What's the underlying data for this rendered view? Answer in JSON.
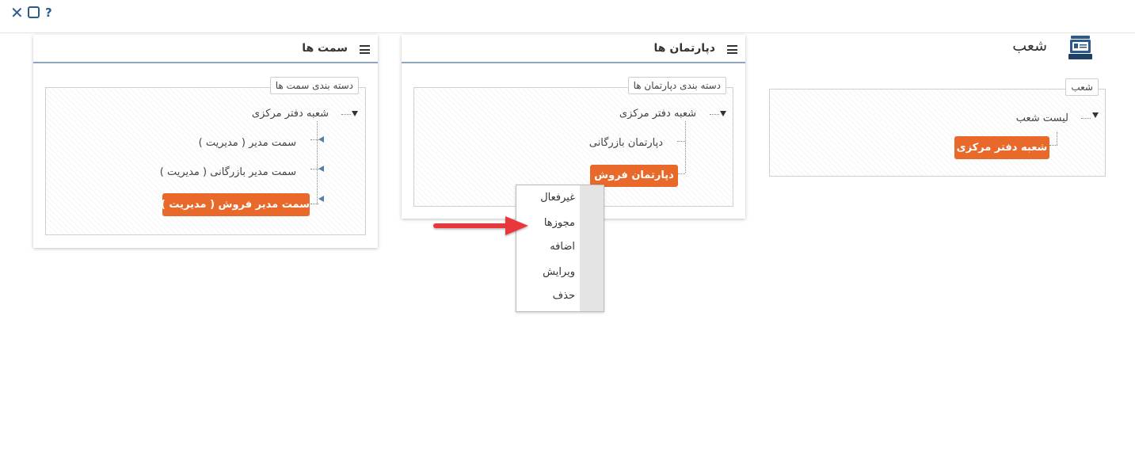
{
  "window_controls": {
    "close_icon": "close-icon",
    "maximize_icon": "maximize-icon",
    "help_label": "?"
  },
  "page": {
    "title": "شعب",
    "icon": "branch-icon"
  },
  "panels": {
    "positions": {
      "header_title": "سمت ها",
      "legend": "دسته بندی سمت ها",
      "root": "شعبه دفتر مرکزی",
      "items": [
        "سمت مدیر ( مدیریت )",
        "سمت مدیر بازرگانی ( مدیریت )"
      ],
      "selected": "سمت مدیر فروش ( مدیریت )"
    },
    "departments": {
      "header_title": "دپارتمان ها",
      "legend": "دسته بندی دپارتمان ها",
      "root": "شعبه دفتر مرکزی",
      "items": [
        "دپارتمان بازرگانی"
      ],
      "selected": "دپارتمان فروش"
    },
    "branches": {
      "legend": "شعب",
      "root": "لیست شعب",
      "selected": "شعبه دفتر مرکزی"
    }
  },
  "context_menu": {
    "items": [
      "غیرفعال",
      "مجوزها",
      "اضافه",
      "ویرایش",
      "حذف"
    ]
  },
  "colors": {
    "accent": "#e8692a",
    "primary": "#2d5a8c",
    "arrow": "#e8393a"
  }
}
